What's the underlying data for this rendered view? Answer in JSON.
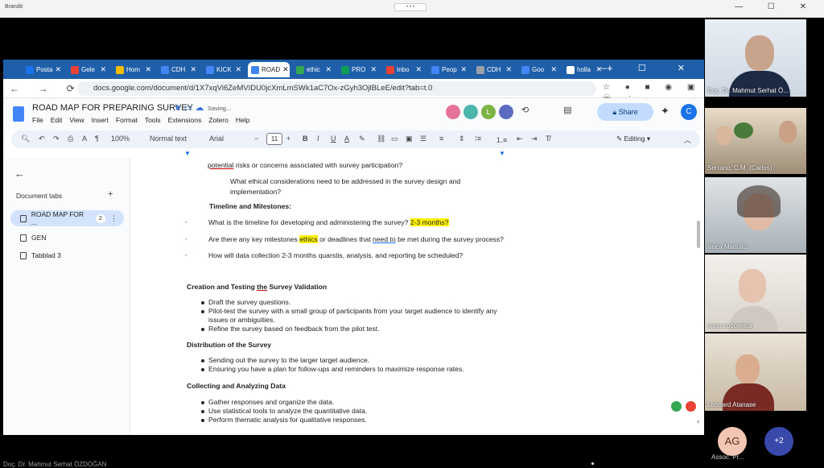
{
  "meeting": {
    "top_left": "Brandit",
    "top_center": "• • •",
    "window_controls": "— ☐ ✕",
    "presenter_name_bottom": "Doç. Dr. Mahmut Serhat ÖZDOĞAN"
  },
  "browser": {
    "tabs": [
      {
        "label": "Posta",
        "fav": "#1a73e8"
      },
      {
        "label": "Gele",
        "fav": "#ea4335"
      },
      {
        "label": "Hom",
        "fav": "#fbbc04"
      },
      {
        "label": "CDH",
        "fav": "#4285f4"
      },
      {
        "label": "KICK",
        "fav": "#4285f4"
      },
      {
        "label": "ROAD",
        "fav": "#4285f4"
      },
      {
        "label": "ethic",
        "fav": "#34a853"
      },
      {
        "label": "PRO",
        "fav": "#0f9d58"
      },
      {
        "label": "Inbo",
        "fav": "#ea4335"
      },
      {
        "label": "Peop",
        "fav": "#4285f4"
      },
      {
        "label": "CDH",
        "fav": "#9aa0a6"
      },
      {
        "label": "Goo",
        "fav": "#4285f4"
      },
      {
        "label": "holla",
        "fav": "#ffffff"
      }
    ],
    "active_tab_index": 5,
    "url": "docs.google.com/document/d/1X7xqVi6ZeMVIDU0jcXmLmSWk1aC7Ox-zGyh3OjlBLeE/edit?tab=t.0"
  },
  "docs": {
    "title": "ROAD MAP FOR PREPARING SURVEY",
    "saving": "Saving...",
    "menu": [
      "File",
      "Edit",
      "View",
      "Insert",
      "Format",
      "Tools",
      "Extensions",
      "Zotero",
      "Help"
    ],
    "collaborators": [
      {
        "initial": "",
        "color": "#e57399"
      },
      {
        "initial": "",
        "color": "#4db6ac"
      },
      {
        "initial": "L",
        "color": "#7cb342"
      },
      {
        "initial": "",
        "color": "#5c6bc0"
      }
    ],
    "share_label": "Share",
    "account_initial": "C",
    "toolbar": {
      "zoom": "100%",
      "style": "Normal text",
      "font": "Arial",
      "font_size": "11",
      "mode": "Editing"
    }
  },
  "sidebar": {
    "heading": "Document tabs",
    "tabs": [
      {
        "label": "ROAD MAP FOR ...",
        "badge": "2"
      },
      {
        "label": "GEN",
        "badge": ""
      },
      {
        "label": "Tabblad 3",
        "badge": ""
      }
    ]
  },
  "document": {
    "line0": "potential risks or concerns associated with survey participation?",
    "line0_prefix": "potential",
    "line1": "What ethical considerations need to be addressed in the survey design and",
    "line2": "implementation?",
    "timeline_heading": "Timeline and Milestones:",
    "q1": "What is the timeline for developing and administering the survey?",
    "q1_hl": "2-3 months?",
    "q2_a": "Are there any key milestones",
    "q2_hl": "ethics",
    "q2_b": "or deadlines that",
    "q2_ul": "need to",
    "q2_c": "be met during the survey process?",
    "q3_a": "How will data collection",
    "q3_b": "2-3 months quarst",
    "q3_c": "is, analysis, and reporting be scheduled?",
    "sec1": "Creation and Testing the Survey Validation",
    "sec1_items": [
      "Draft the survey questions.",
      "Pilot-test the survey with a small group of participants from your target audience to identify any",
      "issues or ambiguities.",
      "Refine the survey based on feedback from the pilot test."
    ],
    "sec2": "Distribution of the Survey",
    "sec2_items": [
      "Sending out the survey to the larger target audience.",
      "Ensuring you have a plan for follow-ups and reminders to maximize response rates."
    ],
    "sec3": "Collecting and Analyzing Data",
    "sec3_items": [
      "Gather responses and organize the data.",
      "Use statistical tools to analyze the quantitative data.",
      "Perform thematic analysis for qualitative responses."
    ]
  },
  "participants": [
    {
      "name": "Doç. Dr. Mahmut Serhat Ö..."
    },
    {
      "name": "Serrano, C.M. (Carlos)"
    },
    {
      "name": "Ilinca Manoliu"
    },
    {
      "name": "oana cucoveica"
    },
    {
      "name": "Leonard Atanase"
    }
  ],
  "extra": {
    "ag_initials": "AG",
    "ag_label": "Assoc. Pr...",
    "more_count": "+2"
  }
}
